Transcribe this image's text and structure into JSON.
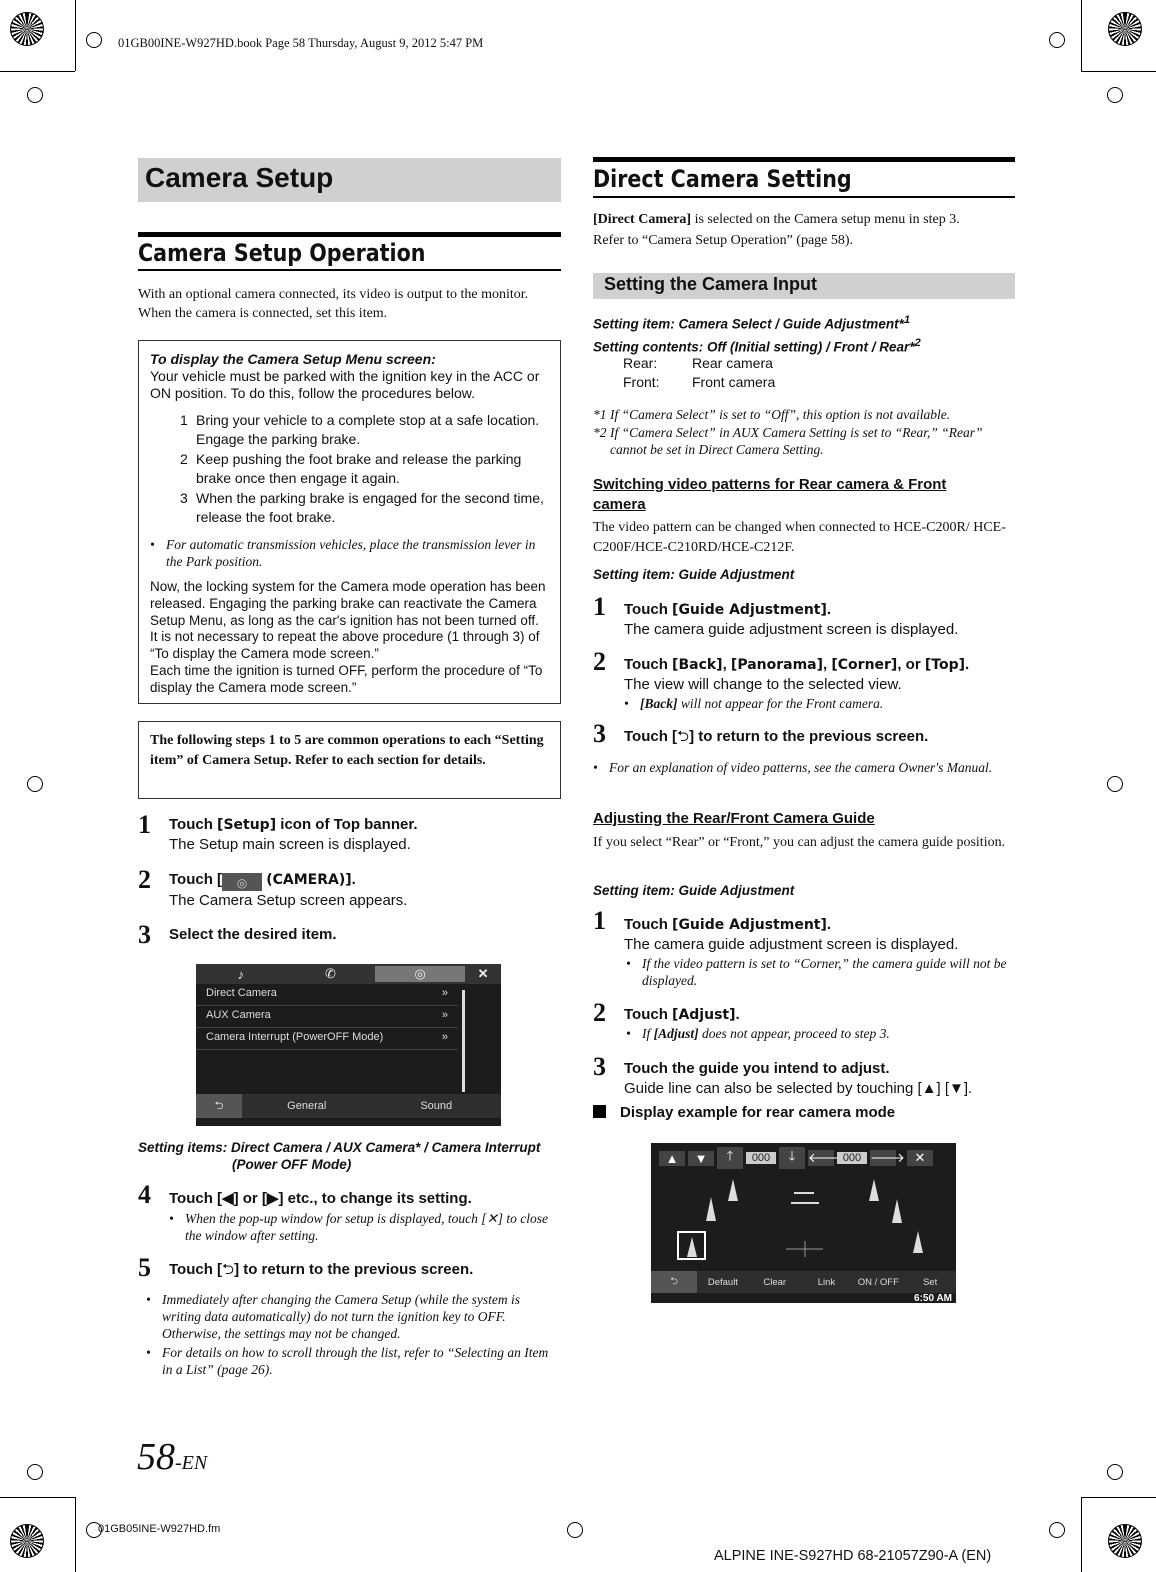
{
  "header": {
    "bookinfo": "01GB00INE-W927HD.book  Page 58  Thursday, August 9, 2012  5:47 PM"
  },
  "footer": {
    "page_num": "58",
    "page_suffix": "-EN",
    "file": "01GB05INE-W927HD.fm",
    "model": "ALPINE INE-S927HD 68-21057Z90-A (EN)"
  },
  "left": {
    "title": "Camera Setup",
    "section": "Camera Setup Operation",
    "intro": [
      "With an optional camera connected, its video is output to the monitor.",
      "When the camera is connected, set this item."
    ],
    "box1": {
      "heading": "To display the Camera Setup Menu screen:",
      "text": "Your vehicle must be parked with the ignition key in the ACC or ON position. To do this, follow the procedures below.",
      "steps": [
        {
          "n": "1",
          "t": "Bring your vehicle to a complete stop at a safe location. Engage the parking brake."
        },
        {
          "n": "2",
          "t": "Keep pushing the foot brake and release the parking brake once then engage it again."
        },
        {
          "n": "3",
          "t": "When the parking brake is engaged for the second time, release the foot brake."
        }
      ],
      "note": "For automatic transmission vehicles, place the transmission lever in the Park position.",
      "para1": "Now, the locking system for the Camera mode operation has been released. Engaging the parking brake can reactivate the Camera Setup Menu, as long as the car's ignition has not been turned off. It is not necessary to repeat the above procedure (1 through 3) of “To display the Camera mode screen.”",
      "para2": "Each time the ignition is turned OFF, perform the procedure of “To display the Camera mode screen.”"
    },
    "box2": "The following steps 1 to 5 are common operations to each “Setting item” of Camera Setup. Refer to each section for details.",
    "steps": [
      {
        "n": "1",
        "a": "Touch ",
        "k": "[Setup]",
        "b": " icon of  Top banner.",
        "d": "The Setup main screen is displayed."
      },
      {
        "n": "2",
        "a": "Touch [",
        "k": "(CAMERA)]",
        "b": ".",
        "d": "The Camera Setup screen appears."
      },
      {
        "n": "3",
        "a": "Select the desired item."
      },
      {
        "n": "4",
        "a": "Touch [◀] or [▶] etc., to change its setting.",
        "note": "When the pop-up window for setup is displayed, touch [✕] to close the window after setting."
      },
      {
        "n": "5",
        "a": "Touch [",
        "b": "] to return to the previous screen."
      }
    ],
    "screen": {
      "items": [
        "Direct Camera",
        "AUX Camera",
        "Camera Interrupt (PowerOFF Mode)"
      ],
      "bottom": [
        "General",
        "Sound"
      ]
    },
    "setting_items": "Setting items: Direct Camera / AUX Camera* / Camera Interrupt",
    "setting_items2": "(Power OFF Mode)",
    "notes": [
      "Immediately after changing the Camera Setup (while the system is writing data automatically) do not turn the ignition key to OFF. Otherwise, the settings may not be changed.",
      "For details on how to scroll through the list, refer to “Selecting an Item in a List” (page 26)."
    ]
  },
  "right": {
    "section": "Direct Camera Setting",
    "intro_b": "[Direct Camera]",
    "intro": " is selected on the Camera setup menu in step 3.",
    "intro2": "Refer to “Camera Setup Operation” (page 58).",
    "subtitle": "Setting the Camera Input",
    "item1": "Setting item: Camera Select / Guide Adjustment*",
    "item1_sup": "1",
    "item2": "Setting contents: Off (Initial setting) / Front / Rear*",
    "item2_sup": "2",
    "defs": [
      {
        "k": "Rear:",
        "v": "Rear camera"
      },
      {
        "k": "Front:",
        "v": "Front camera"
      }
    ],
    "fn": [
      {
        "m": "*1",
        "t": "If “Camera Select” is set to “Off”, this option is not available."
      },
      {
        "m": "*2",
        "t": "If “Camera Select” in AUX Camera Setting is set to “Rear,” “Rear” cannot be set in Direct Camera Setting."
      }
    ],
    "sub1": "Switching video patterns for Rear camera & Front camera",
    "sub1_text": "The video pattern can be changed when connected to HCE-C200R/ HCE-C200F/HCE-C210RD/HCE-C212F.",
    "sub1_item": "Setting item: Guide Adjustment",
    "s1": {
      "a": "Touch ",
      "k": "[Guide Adjustment]",
      "b": ".",
      "d": "The camera guide adjustment screen is displayed."
    },
    "s2": {
      "a": "Touch ",
      "k1": "[Back]",
      "k2": "[Panorama]",
      "k3": "[Corner]",
      "k4": "[Top]",
      "c": ", ",
      "or": ", or ",
      "d": "The view will change to the selected view.",
      "note_b": "[Back]",
      "note": " will not appear for the Front camera."
    },
    "s3": {
      "a": "Touch [",
      "b": "] to return to the previous screen."
    },
    "s3_note": "For an explanation of video patterns, see the camera Owner's Manual.",
    "sub2": "Adjusting the Rear/Front Camera Guide",
    "sub2_text": "If you select “Rear” or “Front,” you can adjust the camera guide position.",
    "sub2_item": "Setting item: Guide Adjustment",
    "t1": {
      "a": "Touch ",
      "k": "[Guide Adjustment]",
      "b": ".",
      "d": "The camera guide adjustment screen is displayed.",
      "note": "If the video pattern is set to “Corner,” the camera guide will not be displayed."
    },
    "t2": {
      "a": "Touch ",
      "k": "[Adjust]",
      "b": ".",
      "note_b": "[Adjust]",
      "note_a": "If ",
      "note": " does not appear, proceed to step 3."
    },
    "t3": {
      "a": "Touch the guide you intend to adjust.",
      "d": "Guide line can also be selected by touching [▲] [▼]."
    },
    "display_example": "Display example for rear camera mode",
    "screen": {
      "values": [
        "000",
        "000"
      ],
      "bottom": [
        "Default",
        "Clear",
        "Link",
        "ON / OFF",
        "Set"
      ],
      "time": "6:50 AM"
    }
  }
}
